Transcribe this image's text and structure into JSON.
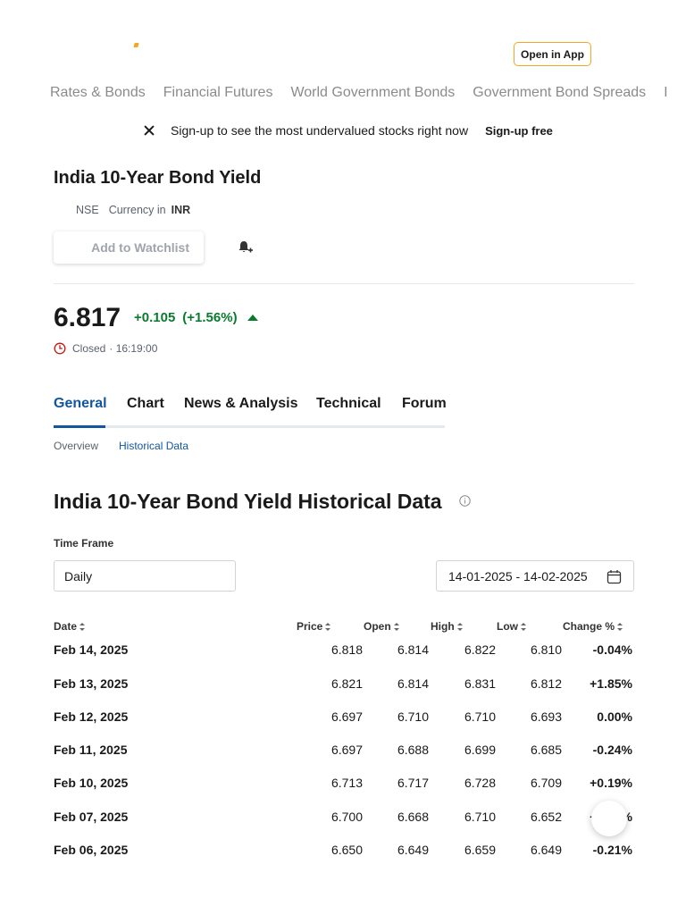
{
  "header": {
    "open_in_app": "Open in App"
  },
  "nav": {
    "items": [
      {
        "label": "Rates & Bonds"
      },
      {
        "label": "Financial Futures"
      },
      {
        "label": "World Government Bonds"
      },
      {
        "label": "Government Bond Spreads"
      },
      {
        "label": "I"
      }
    ]
  },
  "banner": {
    "text": "Sign-up to see the most undervalued stocks right now",
    "cta": "Sign-up free"
  },
  "instrument": {
    "title": "India 10-Year Bond Yield",
    "exchange": "NSE",
    "currency_label": "Currency in",
    "currency": "INR",
    "watchlist_label": "Add to Watchlist",
    "price": "6.817",
    "change": "+0.105",
    "change_pct": "(+1.56%)",
    "status": "Closed",
    "time": "· 16:19:00"
  },
  "tabs": [
    {
      "label": "General"
    },
    {
      "label": "Chart"
    },
    {
      "label": "News & Analysis"
    },
    {
      "label": "Technical"
    },
    {
      "label": "Forum"
    }
  ],
  "subnav": [
    {
      "label": "Overview"
    },
    {
      "label": "Historical Data"
    }
  ],
  "historical": {
    "title": "India 10-Year Bond Yield Historical Data",
    "timeframe_label": "Time Frame",
    "timeframe_value": "Daily",
    "date_range": "14-01-2025 - 14-02-2025",
    "columns": [
      "Date",
      "Price",
      "Open",
      "High",
      "Low",
      "Change %"
    ],
    "rows": [
      {
        "date": "Feb 14, 2025",
        "price": "6.818",
        "open": "6.814",
        "high": "6.822",
        "low": "6.810",
        "change": "-0.04%"
      },
      {
        "date": "Feb 13, 2025",
        "price": "6.821",
        "open": "6.814",
        "high": "6.831",
        "low": "6.812",
        "change": "+1.85%"
      },
      {
        "date": "Feb 12, 2025",
        "price": "6.697",
        "open": "6.710",
        "high": "6.710",
        "low": "6.693",
        "change": "0.00%"
      },
      {
        "date": "Feb 11, 2025",
        "price": "6.697",
        "open": "6.688",
        "high": "6.699",
        "low": "6.685",
        "change": "-0.24%"
      },
      {
        "date": "Feb 10, 2025",
        "price": "6.713",
        "open": "6.717",
        "high": "6.728",
        "low": "6.709",
        "change": "+0.19%"
      },
      {
        "date": "Feb 07, 2025",
        "price": "6.700",
        "open": "6.668",
        "high": "6.710",
        "low": "6.652",
        "change": "+0.75%"
      },
      {
        "date": "Feb 06, 2025",
        "price": "6.650",
        "open": "6.649",
        "high": "6.659",
        "low": "6.649",
        "change": "-0.21%"
      }
    ]
  },
  "colors": {
    "positive": "#0a7a2f",
    "negative": "#c8140e",
    "accent": "#1256a0",
    "brand": "#f5a623"
  }
}
